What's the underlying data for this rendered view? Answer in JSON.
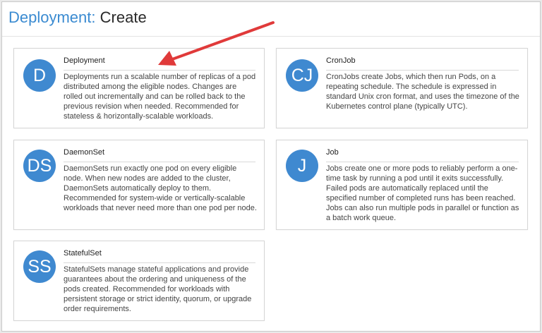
{
  "header": {
    "crumb": "Deployment:",
    "page": "Create"
  },
  "cards": [
    {
      "initials": "D",
      "name": "Deployment",
      "description": "Deployments run a scalable number of replicas of a pod distributed among the eligible nodes. Changes are rolled out incrementally and can be rolled back to the previous revision when needed. Recommended for stateless & horizontally-scalable workloads."
    },
    {
      "initials": "CJ",
      "name": "CronJob",
      "description": "CronJobs create Jobs, which then run Pods, on a repeating schedule. The schedule is expressed in standard Unix cron format, and uses the timezone of the Kubernetes control plane (typically UTC)."
    },
    {
      "initials": "DS",
      "name": "DaemonSet",
      "description": "DaemonSets run exactly one pod on every eligible node. When new nodes are added to the cluster, DaemonSets automatically deploy to them. Recommended for system-wide or vertically-scalable workloads that never need more than one pod per node."
    },
    {
      "initials": "J",
      "name": "Job",
      "description": "Jobs create one or more pods to reliably perform a one-time task by running a pod until it exits successfully. Failed pods are automatically replaced until the specified number of completed runs has been reached. Jobs can also run multiple pods in parallel or function as a batch work queue."
    },
    {
      "initials": "SS",
      "name": "StatefulSet",
      "description": "StatefulSets manage stateful applications and provide guarantees about the ordering and uniqueness of the pods created. Recommended for workloads with persistent storage or strict identity, quorum, or upgrade order requirements."
    }
  ],
  "colors": {
    "accent": "#3b8bd1",
    "avatar": "#3f89d0",
    "arrow": "#e03a3a"
  }
}
